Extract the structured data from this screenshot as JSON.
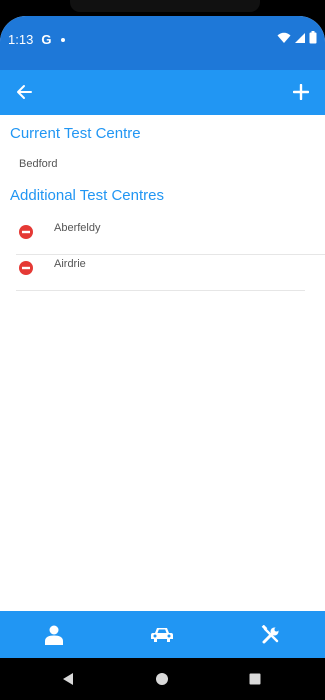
{
  "status_bar": {
    "time": "1:13",
    "google_glyph": "G",
    "icons": [
      "wifi-icon",
      "signal-icon",
      "battery-icon"
    ]
  },
  "app_bar": {
    "back_icon": "arrow-left-icon",
    "add_icon": "plus-icon"
  },
  "current": {
    "title": "Current Test Centre",
    "value": "Bedford"
  },
  "additional": {
    "title": "Additional Test Centres",
    "items": [
      {
        "label": "Aberfeldy"
      },
      {
        "label": "Airdrie"
      }
    ]
  },
  "bottom_nav": {
    "items": [
      "person-icon",
      "car-icon",
      "tools-icon"
    ]
  },
  "system_nav": {
    "items": [
      "back-triangle-icon",
      "home-circle-icon",
      "recents-square-icon"
    ]
  },
  "colors": {
    "status_bar": "#1e78d8",
    "primary": "#2196f3",
    "remove": "#e53935"
  }
}
